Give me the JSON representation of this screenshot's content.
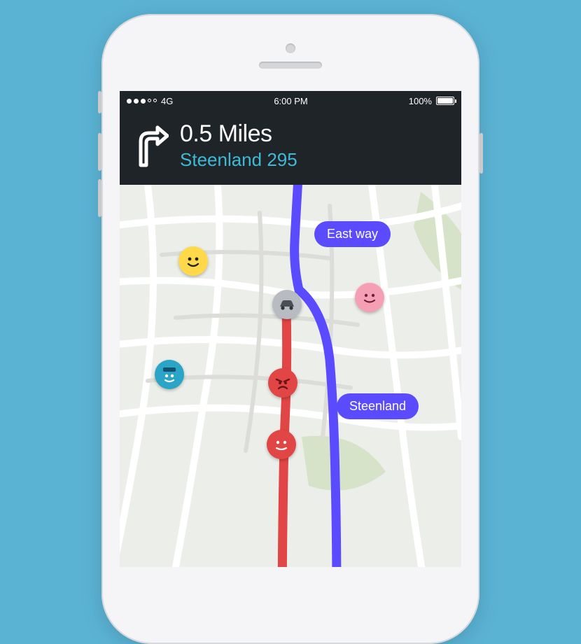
{
  "status": {
    "carrier": "4G",
    "time": "6:00 PM",
    "battery_pct": "100%"
  },
  "nav": {
    "distance": "0.5 Miles",
    "road": "Steenland 295"
  },
  "map": {
    "labels": {
      "eastway": "East way",
      "steenland": "Steenland"
    }
  }
}
